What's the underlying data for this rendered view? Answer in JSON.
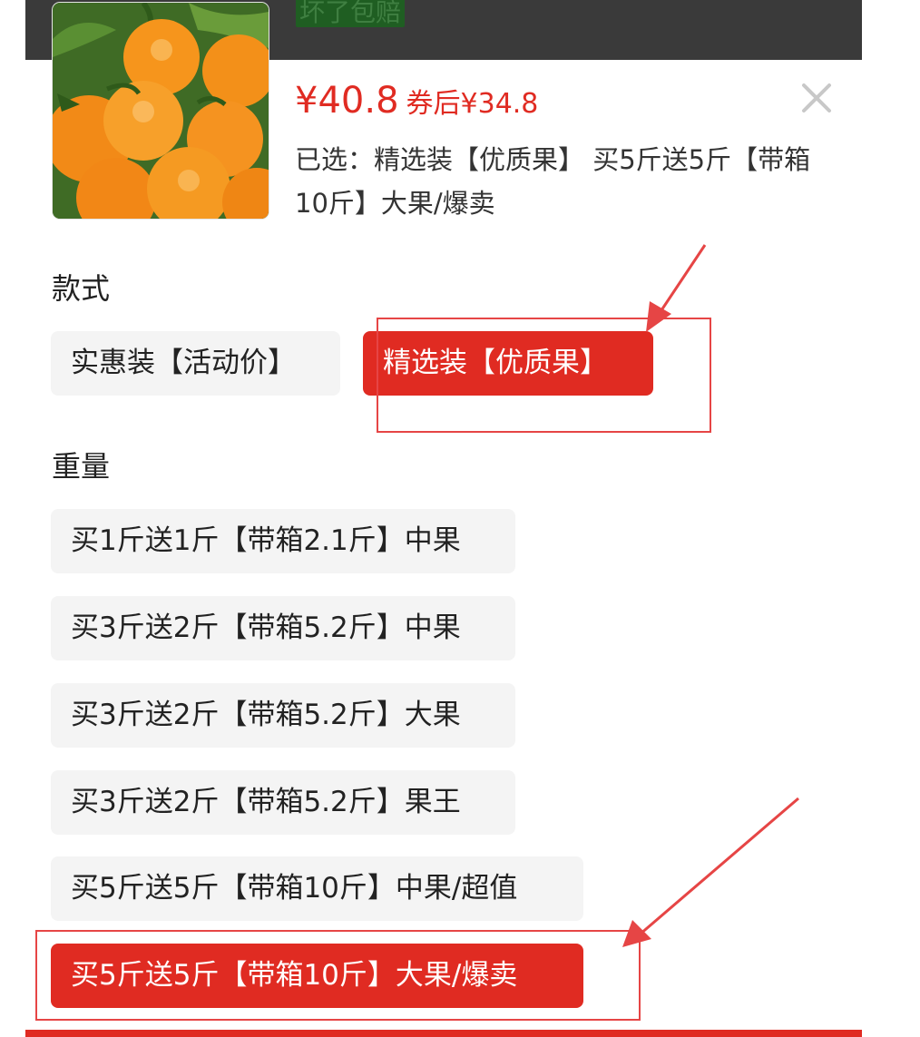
{
  "banner": {
    "text": "坏了包赔"
  },
  "product": {
    "price": "¥40.8",
    "coupon_price": "券后¥34.8",
    "selected_label": "已选：",
    "selected_value": "精选装【优质果】 买5斤送5斤【带箱10斤】大果/爆卖"
  },
  "style_section": {
    "title": "款式",
    "options": [
      {
        "label": "实惠装【活动价】",
        "selected": false
      },
      {
        "label": "精选装【优质果】",
        "selected": true
      }
    ]
  },
  "weight_section": {
    "title": "重量",
    "options": [
      {
        "label": "买1斤送1斤【带箱2.1斤】中果",
        "selected": false
      },
      {
        "label": "买3斤送2斤【带箱5.2斤】中果",
        "selected": false
      },
      {
        "label": "买3斤送2斤【带箱5.2斤】大果",
        "selected": false
      },
      {
        "label": "买3斤送2斤【带箱5.2斤】果王",
        "selected": false
      },
      {
        "label": "买5斤送5斤【带箱10斤】中果/超值",
        "selected": false
      },
      {
        "label": "买5斤送5斤【带箱10斤】大果/爆卖",
        "selected": true
      }
    ]
  },
  "icons": {
    "close": "close-icon",
    "product_image": "orange-fruit-image"
  },
  "colors": {
    "accent": "#e02b22",
    "option_bg": "#f4f4f4",
    "annotation": "#e64545"
  }
}
